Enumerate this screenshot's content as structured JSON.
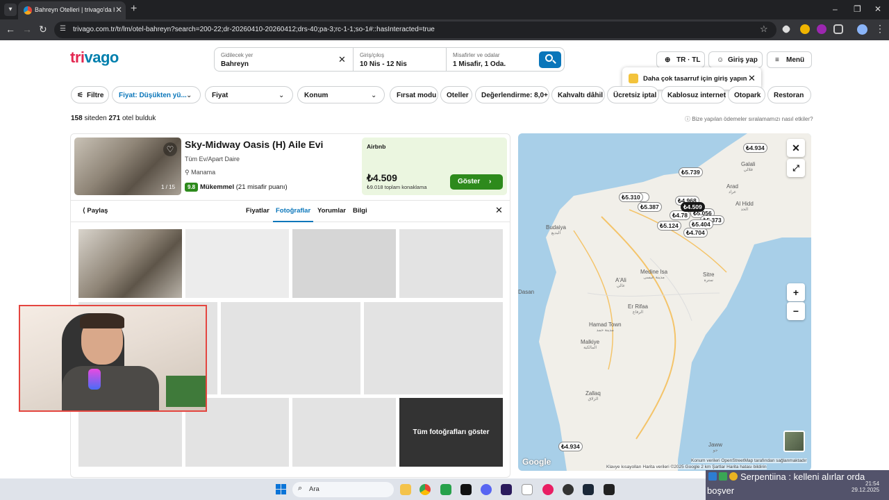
{
  "browser": {
    "tab_title": "Bahreyn Otelleri | trivago'da hemen",
    "url": "trivago.com.tr/tr/lm/otel-bahreyn?search=200-22;dr-20260410-20260412;drs-40;pa-3;rc-1-1;so-1#::hasInteracted=true"
  },
  "header": {
    "logo_part1": "tri",
    "logo_part2": "vago",
    "search": {
      "dest_label": "Gidilecek yer",
      "dest_value": "Bahreyn",
      "dates_label": "Giriş/çıkış",
      "dates_value": "10 Nis - 12 Nis",
      "guests_label": "Misafirler ve odalar",
      "guests_value": "1 Misafir, 1 Oda."
    },
    "locale_btn": "TR · TL",
    "login_btn": "Giriş yap",
    "menu_btn": "Menü",
    "tooltip": "Daha çok tasarruf için giriş yapın"
  },
  "filters": {
    "filter": "Filtre",
    "sort": "Fiyat: Düşükten yü...",
    "price": "Fiyat",
    "location": "Konum",
    "chips": [
      "Fırsat modu",
      "Oteller",
      "Değerlendirme: 8,0+",
      "Kahvaltı dâhil",
      "Ücretsiz iptal",
      "Kablosuz internet",
      "Otopark",
      "Restoran"
    ]
  },
  "results": {
    "sites": "158",
    "sites_suffix": " siteden ",
    "hotels": "271",
    "hotels_suffix": " otel bulduk",
    "pay_disclaimer": "Bize yapılan ödemeler sıralamamızı nasıl etkiler?"
  },
  "hotel": {
    "name": "Sky-Midway Oasis (H) Aile Evi",
    "type": "Tüm Ev/Apart Daire",
    "location": "Manama",
    "rating": "9.8",
    "rating_word": "Mükemmel",
    "rating_count": " (21 misafir puanı)",
    "photo_counter": "1 / 15",
    "deal_provider": "Airbnb",
    "deal_price": "₺4.509",
    "deal_total": "₺9.018 toplam konaklama",
    "deal_button": "Göster",
    "share": "Paylaş",
    "tabs": [
      "Fiyatlar",
      "Fotoğraflar",
      "Yorumlar",
      "Bilgi"
    ],
    "show_all_photos": "Tüm fotoğrafları göster"
  },
  "map": {
    "pins": [
      "₺4.934",
      "₺5.739",
      "₺5.310",
      "₺5.387",
      "₺4.968",
      "₺4.509",
      "₺4.78",
      "₺5.056",
      "₺5.124",
      "₺5.404",
      "₺5.373",
      "₺4.704",
      "₺4.934"
    ],
    "places": [
      {
        "name": "Budaiya",
        "ar": "البديع"
      },
      {
        "name": "Galali",
        "ar": "قلالي"
      },
      {
        "name": "Arad",
        "ar": "عراد"
      },
      {
        "name": "Al Hidd",
        "ar": "الحد"
      },
      {
        "name": "Medine Isa",
        "ar": "مدينة عيسى"
      },
      {
        "name": "Sitre",
        "ar": "سترة"
      },
      {
        "name": "A'Ali",
        "ar": "عالي"
      },
      {
        "name": "Er Rifaa",
        "ar": "الرفاع"
      },
      {
        "name": "Hamad Town",
        "ar": "مدينة حمد"
      },
      {
        "name": "Malkiye",
        "ar": "المالكية"
      },
      {
        "name": "Zallaq",
        "ar": "الزلاق"
      },
      {
        "name": "Jaww",
        "ar": "جو"
      },
      {
        "name": "Dasan",
        "ar": ""
      }
    ],
    "google": "Google",
    "attr_top": "Konum verileri OpenStreetMap tarafından sağlanmaktadır",
    "attr_bottom": "Klavye kısayolları   Harita verileri ©2025 Google   2 km   Şartlar   Harita hatası bildirin"
  },
  "stream": {
    "ticker_line1": "Serpentiina : kelleni alırlar orda",
    "ticker_line2": "boşver"
  },
  "taskbar": {
    "search_label": "Ara",
    "time": "21:54",
    "date": "29.12.2025"
  },
  "colors": {
    "brand_red": "#e32851",
    "brand_blue": "#007fad",
    "accent": "#0a76ba",
    "deal_green": "#2d8a1c"
  }
}
